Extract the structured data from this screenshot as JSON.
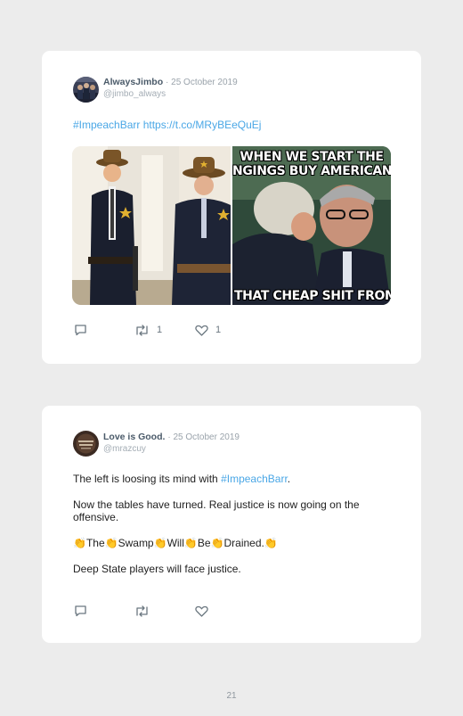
{
  "tweets": [
    {
      "name": "AlwaysJimbo",
      "date": "· 25 October 2019",
      "handle": "@jimbo_always",
      "hashtag": "#ImpeachBarr",
      "url": "https://t.co/MRyBEeQuEj",
      "meme_top_line1": "WHEN WE START THE",
      "meme_top_line2": "NGINGS BUY AMERICAN RO",
      "meme_bottom": "THAT CHEAP SHIT FROM C",
      "retweets": "1",
      "likes": "1"
    },
    {
      "name": "Love is Good.",
      "date": "· 25 October 2019",
      "handle": "@mrazcuy",
      "line1_pre": "The left is loosing its mind with ",
      "line1_hashtag": "#ImpeachBarr",
      "line1_post": ".",
      "para2": "Now the tables have turned. Real justice is now going on the offensive.",
      "clap_words": [
        "The",
        "Swamp",
        "Will",
        "Be",
        "Drained."
      ],
      "para4": "Deep State players will face justice."
    }
  ],
  "icons": {
    "reply": "reply-icon",
    "retweet": "retweet-icon",
    "like": "heart-icon",
    "clap": "clapping-hands-icon"
  },
  "page_number": "21",
  "colors": {
    "link": "#4aa7e6",
    "name": "#4a5a69",
    "background": "#ececec"
  }
}
